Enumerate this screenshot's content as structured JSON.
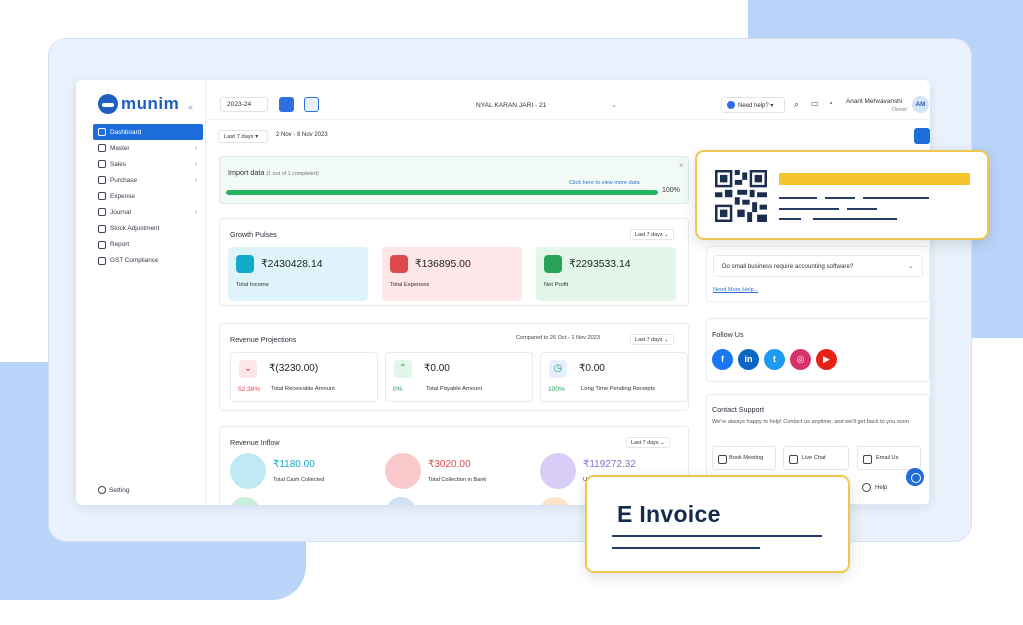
{
  "sidebar": {
    "logo": "munim",
    "collapse_glyph": "«",
    "items": [
      {
        "label": "Dashboard",
        "active": true,
        "has_chevron": false
      },
      {
        "label": "Master",
        "has_chevron": true
      },
      {
        "label": "Sales",
        "has_chevron": true
      },
      {
        "label": "Purchase",
        "has_chevron": true
      },
      {
        "label": "Expense",
        "has_chevron": false
      },
      {
        "label": "Journal",
        "has_chevron": true
      },
      {
        "label": "Stock Adjustment",
        "has_chevron": false
      },
      {
        "label": "Report",
        "has_chevron": false
      },
      {
        "label": "GST Compliance",
        "has_chevron": false
      }
    ],
    "setting_label": "Setting"
  },
  "topbar": {
    "year": "2023-24",
    "company": "NYAL KARAN JARI - 21",
    "help": "Need help?",
    "user_name": "Anant Mehvavanshi",
    "user_role": "Owner",
    "avatar_initials": "AM"
  },
  "filter": {
    "range_select": "Last 7 days",
    "range_text": "2 Nov - 8 Nov 2023"
  },
  "import": {
    "title": "Import data",
    "subtitle": "(1 out of 1 completed)",
    "link": "Click here to view more data",
    "progress": 100,
    "progress_label": "100%"
  },
  "growth": {
    "title": "Growth Pulses",
    "period": "Last 7 days",
    "stats": [
      {
        "value": "₹2430428.14",
        "label": "Total Income",
        "bg": "#dff3fb",
        "icon_color": "#12a9c9"
      },
      {
        "value": "₹136895.00",
        "label": "Total Expenses",
        "bg": "#fde7e8",
        "icon_color": "#e0494f"
      },
      {
        "value": "₹2293533.14",
        "label": "Net Profit",
        "bg": "#e3f6ea",
        "icon_color": "#2aa35a"
      }
    ]
  },
  "projections": {
    "title": "Revenue Projections",
    "compared": "Compared to 26 Oct - 1 Nov 2023",
    "period": "Last 7 days",
    "items": [
      {
        "value": "₹(3230.00)",
        "pct": "52.38%",
        "label": "Total Receivable Amount",
        "glyph": "⌄",
        "color": "#e0494f",
        "bg": "#fde7e8"
      },
      {
        "value": "₹0.00",
        "pct": "0%",
        "label": "Total Payable Amount",
        "glyph": "⌃",
        "color": "#2aa35a",
        "bg": "#e3f6ea"
      },
      {
        "value": "₹0.00",
        "pct": "100%",
        "label": "Long Time Pending Receipts",
        "glyph": "◷",
        "color": "#2aa35a",
        "bg": "#e6efff"
      }
    ]
  },
  "inflow": {
    "title": "Revenue Inflow",
    "period": "Last 7 days",
    "items": [
      {
        "value": "₹1180.00",
        "label": "Total Cash Collected",
        "color": "#18a9c4",
        "bg": "#bfeaf3"
      },
      {
        "value": "₹3020.00",
        "label": "Total Collection in Bank",
        "color": "#e0494f",
        "bg": "#f9c9cb"
      },
      {
        "value": "₹119272.32",
        "label": "Un",
        "color": "#8a6fd6",
        "bg": "#d7cdf6"
      }
    ]
  },
  "faq": {
    "question": "Do small business require accounting software?",
    "more": "Need More Help..."
  },
  "follow": {
    "title": "Follow Us",
    "icons": [
      {
        "name": "facebook-icon",
        "glyph": "f",
        "color": "#1877f2"
      },
      {
        "name": "linkedin-icon",
        "glyph": "in",
        "color": "#0a66c2"
      },
      {
        "name": "twitter-icon",
        "glyph": "t",
        "color": "#1d9bf0"
      },
      {
        "name": "instagram-icon",
        "glyph": "◎",
        "color": "#d6336c"
      },
      {
        "name": "youtube-icon",
        "glyph": "▶",
        "color": "#e62117"
      }
    ]
  },
  "support": {
    "title": "Contact Support",
    "text": "We're always happy to help! Contact us anytime, and we'll get back to you soon",
    "buttons": [
      "Book Meeting",
      "Live Chat",
      "Email Us"
    ],
    "help": "Help"
  },
  "callout": {
    "invoice_title": "E Invoice",
    "accent": "#f0c74e"
  }
}
